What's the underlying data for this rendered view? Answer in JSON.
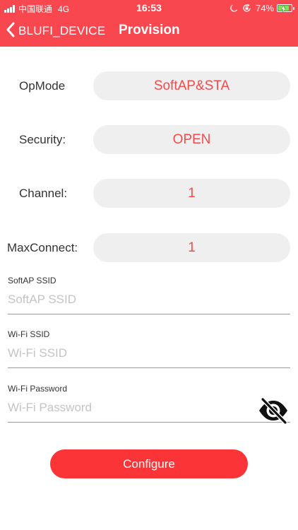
{
  "status_bar": {
    "carrier": "中国联通",
    "network": "4G",
    "time": "16:53",
    "battery_percent": "74%",
    "icons": [
      "signal-bars-icon",
      "moon-icon",
      "rotation-lock-icon",
      "battery-icon",
      "charging-bolt-icon"
    ]
  },
  "nav": {
    "back_label": "BLUFI_DEVICE",
    "title": "Provision"
  },
  "options": [
    {
      "label": "OpMode",
      "value": "SoftAP&STA"
    },
    {
      "label": "Security:",
      "value": "OPEN"
    },
    {
      "label": "Channel:",
      "value": "1"
    },
    {
      "label": "MaxConnect:",
      "value": "1"
    }
  ],
  "fields": [
    {
      "label": "SoftAP SSID",
      "placeholder": "SoftAP SSID",
      "value": ""
    },
    {
      "label": "Wi-Fi SSID",
      "placeholder": "Wi-Fi SSID",
      "value": ""
    },
    {
      "label": "Wi-Fi Password",
      "placeholder": "Wi-Fi Password",
      "value": ""
    }
  ],
  "password_toggle_icon": "eye-slash-icon",
  "configure_label": "Configure",
  "colors": {
    "header": "#f9474f",
    "accent_text": "#f34b4b",
    "pill_background": "#efefef",
    "button": "#fb3537",
    "battery_fill": "#7ee35a"
  }
}
